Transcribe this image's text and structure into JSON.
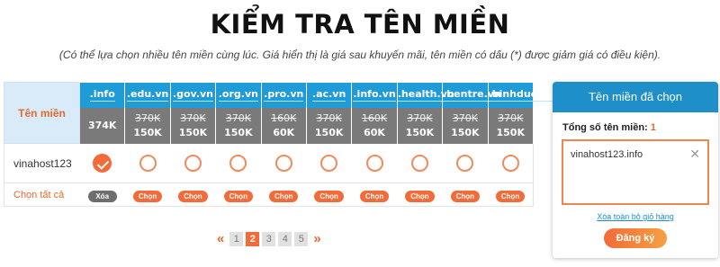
{
  "header": {
    "title": "KIỂM TRA TÊN MIỀN",
    "subtitle": "(Có thể lựa chọn nhiều tên miền cùng lúc. Giá hiển thị là giá sau khuyến mãi, tên miền có dấu (*) được giảm giá có điều kiện)."
  },
  "table": {
    "label_header": "Tên miền",
    "domains": [
      {
        "ext": ".info",
        "old_price": "",
        "price": "374K",
        "selected": true,
        "action": "Xóa"
      },
      {
        "ext": ".edu.vn",
        "old_price": "370K",
        "price": "150K",
        "selected": false,
        "action": "Chọn"
      },
      {
        "ext": ".gov.vn",
        "old_price": "370K",
        "price": "150K",
        "selected": false,
        "action": "Chọn"
      },
      {
        "ext": ".org.vn",
        "old_price": "370K",
        "price": "150K",
        "selected": false,
        "action": "Chọn"
      },
      {
        "ext": ".pro.vn",
        "old_price": "160K",
        "price": "60K",
        "selected": false,
        "action": "Chọn"
      },
      {
        "ext": ".ac.vn",
        "old_price": "370K",
        "price": "150K",
        "selected": false,
        "action": "Chọn"
      },
      {
        "ext": ".info.vn",
        "old_price": "160K",
        "price": "60K",
        "selected": false,
        "action": "Chọn"
      },
      {
        "ext": ".health.vn",
        "old_price": "370K",
        "price": "150K",
        "selected": false,
        "action": "Chọn"
      },
      {
        "ext": ".bentre.vn",
        "old_price": "370K",
        "price": "150K",
        "selected": false,
        "action": "Chọn"
      },
      {
        "ext": ".binhduong.vn",
        "old_price": "370K",
        "price": "150K",
        "selected": false,
        "action": "Chọn"
      }
    ],
    "domain_name": "vinahost123",
    "select_all_label": "Chọn tất cả"
  },
  "pagination": {
    "prev": "«",
    "next": "»",
    "pages": [
      "1",
      "2",
      "3",
      "4",
      "5"
    ],
    "current": "2"
  },
  "cart": {
    "title": "Tên miền đã chọn",
    "count_label": "Tổng số tên miền:",
    "count": "1",
    "items": [
      "vinahost123.info"
    ],
    "remove_symbol": "✕",
    "clear_label": "Xóa toàn bộ giỏ hàng",
    "register_label": "Đăng ký"
  },
  "colors": {
    "accent": "#f26b38",
    "header_blue": "#1f9bd7",
    "price_grey": "#7a7a7a"
  }
}
